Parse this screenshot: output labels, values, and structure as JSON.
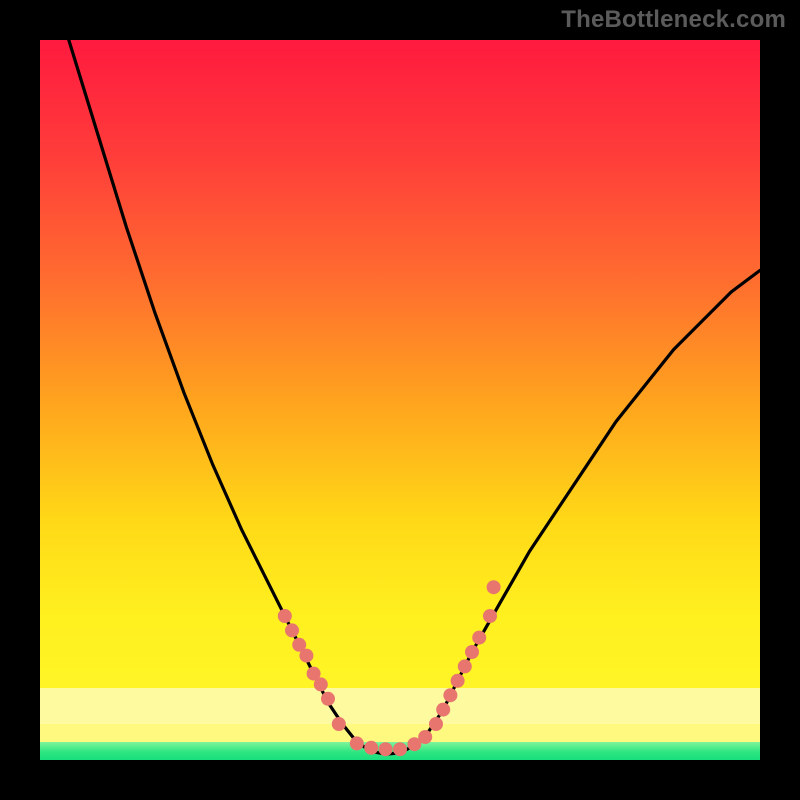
{
  "attribution": "TheBottleneck.com",
  "chart_data": {
    "type": "line",
    "title": "",
    "xlabel": "",
    "ylabel": "",
    "x_range": [
      0,
      100
    ],
    "y_range": [
      0,
      100
    ],
    "curve_points": [
      {
        "x": 4,
        "y": 100
      },
      {
        "x": 8,
        "y": 87
      },
      {
        "x": 12,
        "y": 74
      },
      {
        "x": 16,
        "y": 62
      },
      {
        "x": 20,
        "y": 51
      },
      {
        "x": 24,
        "y": 41
      },
      {
        "x": 28,
        "y": 32
      },
      {
        "x": 32,
        "y": 24
      },
      {
        "x": 36,
        "y": 16
      },
      {
        "x": 38,
        "y": 12
      },
      {
        "x": 40,
        "y": 8
      },
      {
        "x": 42,
        "y": 5
      },
      {
        "x": 44,
        "y": 2.5
      },
      {
        "x": 46,
        "y": 1.2
      },
      {
        "x": 48,
        "y": 0.8
      },
      {
        "x": 50,
        "y": 1.0
      },
      {
        "x": 52,
        "y": 2.0
      },
      {
        "x": 54,
        "y": 4
      },
      {
        "x": 56,
        "y": 7
      },
      {
        "x": 58,
        "y": 11
      },
      {
        "x": 60,
        "y": 15
      },
      {
        "x": 64,
        "y": 22
      },
      {
        "x": 68,
        "y": 29
      },
      {
        "x": 72,
        "y": 35
      },
      {
        "x": 76,
        "y": 41
      },
      {
        "x": 80,
        "y": 47
      },
      {
        "x": 84,
        "y": 52
      },
      {
        "x": 88,
        "y": 57
      },
      {
        "x": 92,
        "y": 61
      },
      {
        "x": 96,
        "y": 65
      },
      {
        "x": 100,
        "y": 68
      }
    ],
    "marker_color": "#e8766f",
    "markers": [
      {
        "x": 34,
        "y": 20
      },
      {
        "x": 35,
        "y": 18
      },
      {
        "x": 36,
        "y": 16
      },
      {
        "x": 37,
        "y": 14.5
      },
      {
        "x": 38,
        "y": 12
      },
      {
        "x": 39,
        "y": 10.5
      },
      {
        "x": 40,
        "y": 8.5
      },
      {
        "x": 41.5,
        "y": 5
      },
      {
        "x": 44,
        "y": 2.3
      },
      {
        "x": 46,
        "y": 1.7
      },
      {
        "x": 48,
        "y": 1.5
      },
      {
        "x": 50,
        "y": 1.5
      },
      {
        "x": 52,
        "y": 2.2
      },
      {
        "x": 53.5,
        "y": 3.2
      },
      {
        "x": 55,
        "y": 5
      },
      {
        "x": 56,
        "y": 7
      },
      {
        "x": 57,
        "y": 9
      },
      {
        "x": 58,
        "y": 11
      },
      {
        "x": 59,
        "y": 13
      },
      {
        "x": 60,
        "y": 15
      },
      {
        "x": 61,
        "y": 17
      },
      {
        "x": 62.5,
        "y": 20
      },
      {
        "x": 63,
        "y": 24
      }
    ],
    "bands": [
      {
        "name": "gradient-main",
        "y_top": 100,
        "y_bottom": 10,
        "style": "red-to-yellow"
      },
      {
        "name": "pale-yellow",
        "y_top": 10,
        "y_bottom": 5,
        "color": "#fdfaa0"
      },
      {
        "name": "mid-yellow",
        "y_top": 5,
        "y_bottom": 2.5,
        "color": "#fff97f"
      },
      {
        "name": "green",
        "y_top": 2.5,
        "y_bottom": 0,
        "color": "#2fe681"
      }
    ]
  }
}
